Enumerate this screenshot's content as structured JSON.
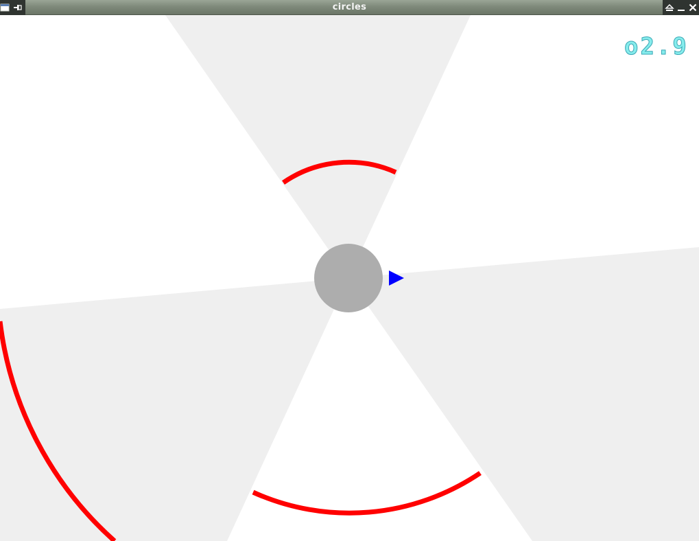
{
  "window": {
    "title": "circles"
  },
  "hud": {
    "timer": "o2.9"
  },
  "colors": {
    "background": "#ffffff",
    "sector_shade": "#efefef",
    "wall": "#ff0000",
    "hub": "#adadad",
    "player": "#0000ff",
    "timer": "#86ecec",
    "titlebar": "#7f8a7b"
  },
  "icons": {
    "window_menu": "window-menu-icon",
    "pin": "pin-icon",
    "shade": "shade-icon",
    "minimize": "minimize-icon",
    "close": "close-icon"
  }
}
